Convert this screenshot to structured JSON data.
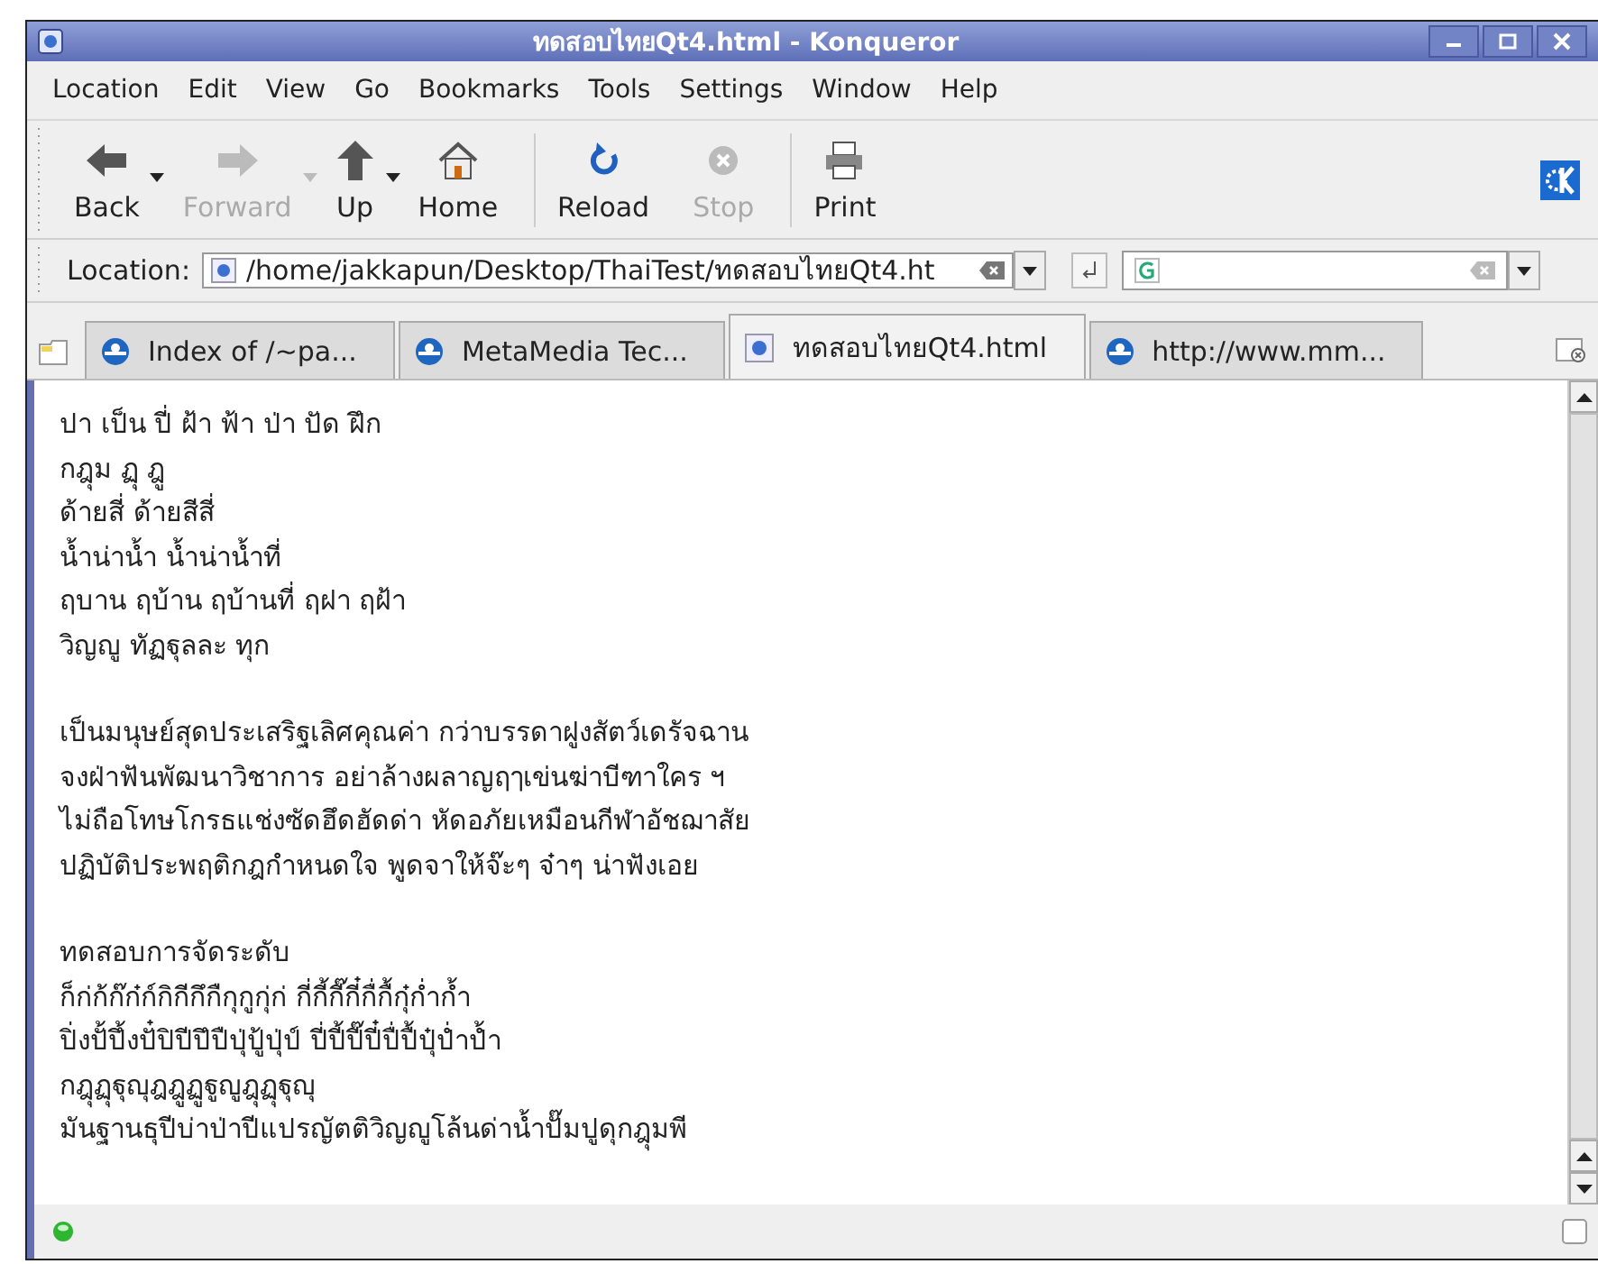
{
  "window": {
    "title": "ทดสอบไทยQt4.html - Konqueror"
  },
  "menu": [
    "Location",
    "Edit",
    "View",
    "Go",
    "Bookmarks",
    "Tools",
    "Settings",
    "Window",
    "Help"
  ],
  "toolbar": [
    {
      "label": "Back",
      "kind": "back",
      "disabled": false,
      "dropdown": true
    },
    {
      "label": "Forward",
      "kind": "forward",
      "disabled": true,
      "dropdown": true
    },
    {
      "label": "Up",
      "kind": "up",
      "disabled": false,
      "dropdown": true
    },
    {
      "label": "Home",
      "kind": "home",
      "disabled": false,
      "dropdown": false
    },
    {
      "label": "Reload",
      "kind": "reload",
      "disabled": false,
      "dropdown": false,
      "separator_before": true
    },
    {
      "label": "Stop",
      "kind": "stop",
      "disabled": true,
      "dropdown": false
    },
    {
      "label": "Print",
      "kind": "print",
      "disabled": false,
      "dropdown": false,
      "separator_before": true
    }
  ],
  "location": {
    "label": "Location:",
    "value": "/home/jakkapun/Desktop/ThaiTest/ทดสอบไทยQt4.ht"
  },
  "tabs": [
    {
      "label": "Index of /~pa...",
      "kind": "web",
      "selected": false
    },
    {
      "label": "MetaMedia Tec...",
      "kind": "web",
      "selected": false
    },
    {
      "label": "ทดสอบไทยQt4.html",
      "kind": "file",
      "selected": true
    },
    {
      "label": "http://www.mm...",
      "kind": "web",
      "selected": false
    }
  ],
  "content": {
    "paragraphs": [
      [
        "ปา เป็น ปี่ ฝ้า ฟ้า ป่า ปัด ฝึก",
        "กฎุม ฏุ ฎู",
        "ด้ายสี่ ด้ายสีสี่",
        "น้ำน่าน้ำ น้ำน่าน้ำที่",
        "ฤบาน ฤบ้าน ฤบ้านที่ ฤฝา ฤฝ้า",
        "วิญญู ทัฏฐุลละ ทุก"
      ],
      [
        "เป็นมนุษย์สุดประเสริฐเลิศคุณค่า กว่าบรรดาฝูงสัตว์เดรัจฉาน",
        "จงฝ่าฟันพัฒนาวิชาการ อย่าล้างผลาญฤๅเข่นฆ่าบีฑาใคร ฯ",
        "ไม่ถือโทษโกรธแช่งซัดฮึดฮัดด่า หัดอภัยเหมือนกีฬาอัชฌาสัย",
        "ปฏิบัติประพฤติกฎกำหนดใจ พูดจาให้จ๊ะๆ จ๋าๆ น่าฟังเอย"
      ],
      [
        "ทดสอบการจัดระดับ",
        "ก็ก่ก้ก๊ก๋ก์กิกีกึกืกุกูกุ่ก่ กี่กี้กี๊กี๋กื่กื้กุ๋ก่ำก้ำ",
        "ปิ่งปั้ปึ้งปั๋ปิปีปึปืปุ่ปู้ปุ่ป์ ปี่ปี้ปี๊ปี๋ปื่ปื้ปุ๋ป่ำป้ำ",
        "กฎุฏุฐุญุฎฎูฏูฐูญูฎุฏุฐุญุ",
        "มันฐานธุปีบ่าป่าปีแปรญัตติวิญญูโล้นด่าน้ำปั๊มปูดุกฎุมพี"
      ]
    ]
  }
}
